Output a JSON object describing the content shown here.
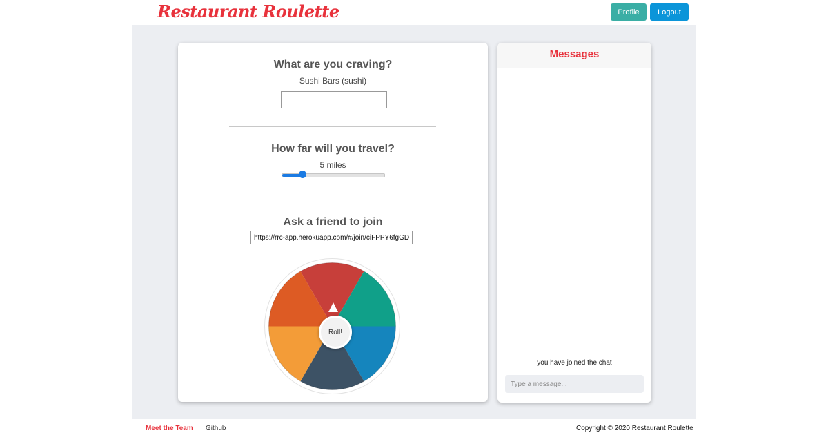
{
  "header": {
    "logo": "Restaurant Roulette",
    "profile_label": "Profile",
    "logout_label": "Logout"
  },
  "craving": {
    "title": "What are you craving?",
    "selection": "Sushi Bars (sushi)",
    "input_value": ""
  },
  "travel": {
    "title": "How far will you travel?",
    "distance_label": "5 miles",
    "slider_fraction": 0.2
  },
  "invite": {
    "title": "Ask a friend to join",
    "link": "https://rrc-app.herokuapp.com/#/join/ciFPPY6fgGD"
  },
  "wheel": {
    "roll_label": "Roll!",
    "colors": [
      "#c73f3a",
      "#10a089",
      "#1585bd",
      "#3d5265",
      "#f39c38",
      "#dd5b24"
    ]
  },
  "messages": {
    "title": "Messages",
    "joined_text": "you have joined the chat",
    "input_placeholder": "Type a message..."
  },
  "footer": {
    "meet_label": "Meet the Team",
    "github_label": "Github",
    "copyright": "Copyright © 2020 Restaurant Roulette"
  },
  "colors": {
    "brand_red": "#e8323c",
    "profile_teal": "#3aaea5",
    "logout_blue": "#0b95d9",
    "slider_blue": "#1b7be3",
    "page_gray": "#eceef2"
  }
}
